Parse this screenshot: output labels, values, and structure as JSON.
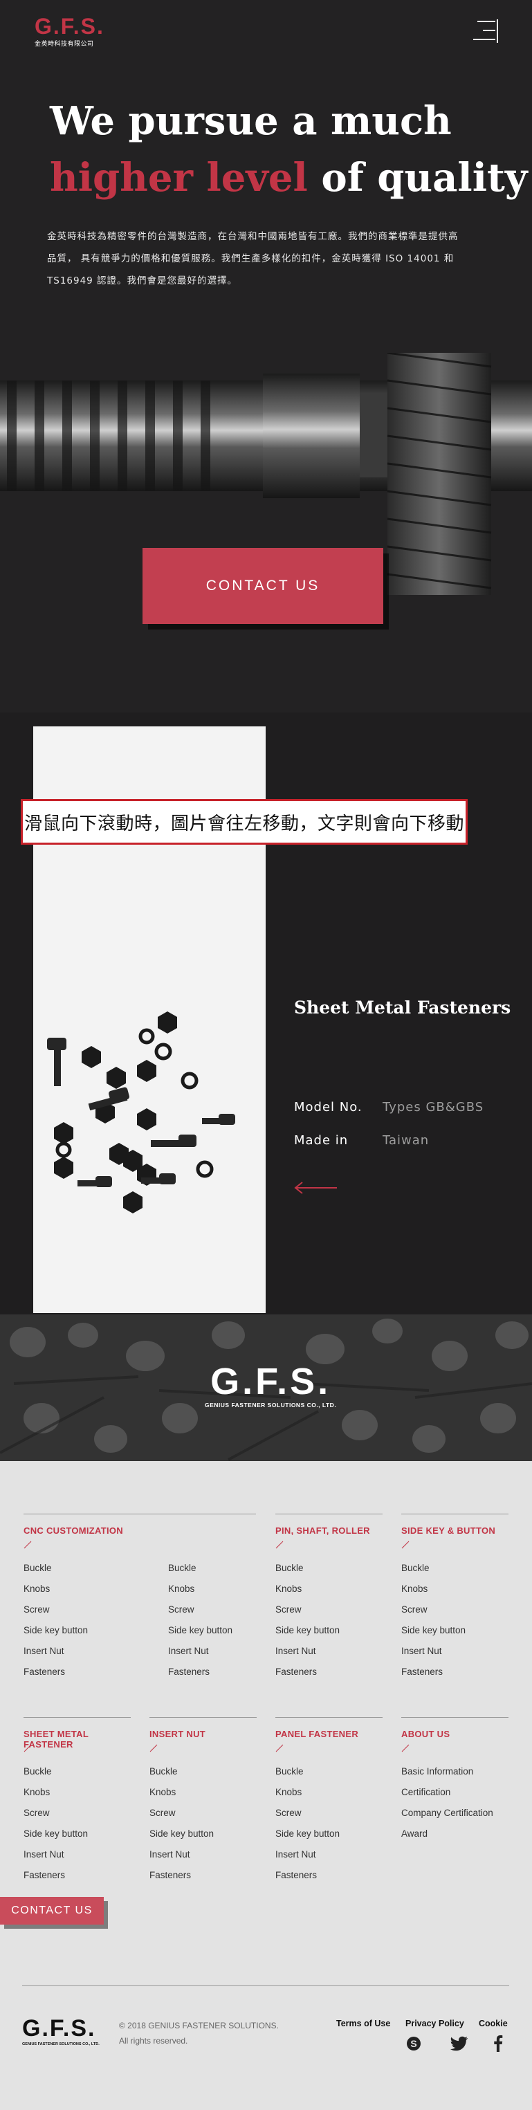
{
  "header": {
    "logo_text": "G.F.S.",
    "logo_subtitle": "金英時科技有限公司",
    "menu_icon": "menu-icon"
  },
  "hero": {
    "title_line1": "We pursue a much",
    "title_accent": "higher level",
    "title_rest": " of quality",
    "description": "金英時科技為精密零件的台灣製造商，在台灣和中國兩地皆有工廠。我們的商業標準是提供高品質， 具有競爭力的價格和優質服務。我們生產多樣化的扣件，金英時獲得 ISO 14001 和TS16949 認證。我們會是您最好的選擇。",
    "cta_label": "CONTACT  US"
  },
  "product": {
    "name": "Sheet Metal Fasteners",
    "specs": [
      {
        "key": "Model No.",
        "value": "Types GB&GBS"
      },
      {
        "key": "Made in",
        "value": "Taiwan"
      }
    ],
    "back_icon": "arrow-left-icon",
    "overlay_note": "滑鼠向下滾動時，圖片會往左移動，文字則會向下移動"
  },
  "banner": {
    "logo_text": "G.F.S.",
    "logo_subtitle": "GENIUS FASTENER SOLUTIONS CO., LTD."
  },
  "footer_nav": {
    "columns_top": [
      {
        "title": "CNC CUSTOMIZATION",
        "items": [
          "Buckle",
          "Knobs",
          "Screw",
          "Side key button",
          "Insert Nut",
          "Fasteners"
        ],
        "items2": [
          "Buckle",
          "Knobs",
          "Screw",
          "Side key button",
          "Insert Nut",
          "Fasteners"
        ]
      },
      {
        "title": "PIN, SHAFT, ROLLER",
        "items": [
          "Buckle",
          "Knobs",
          "Screw",
          "Side key button",
          "Insert Nut",
          "Fasteners"
        ]
      },
      {
        "title": "SIDE KEY & BUTTON",
        "items": [
          "Buckle",
          "Knobs",
          "Screw",
          "Side key button",
          "Insert Nut",
          "Fasteners"
        ]
      }
    ],
    "columns_bottom": [
      {
        "title": "SHEET METAL FASTENER",
        "items": [
          "Buckle",
          "Knobs",
          "Screw",
          "Side key button",
          "Insert Nut",
          "Fasteners"
        ]
      },
      {
        "title": "INSERT NUT",
        "items": [
          "Buckle",
          "Knobs",
          "Screw",
          "Side key button",
          "Insert Nut",
          "Fasteners"
        ]
      },
      {
        "title": "PANEL FASTENER",
        "items": [
          "Buckle",
          "Knobs",
          "Screw",
          "Side key button",
          "Insert Nut",
          "Fasteners"
        ]
      },
      {
        "title": "ABOUT US",
        "items": [
          "Basic Information",
          "Certification",
          "Company Certification",
          "Award"
        ]
      }
    ],
    "cta_label": "CONTACT  US"
  },
  "footer": {
    "logo_text": "G.F.S.",
    "logo_subtitle": "GENIUS FASTENER SOLUTIONS CO., LTD.",
    "copyright_line1": "© 2018 GENIUS FASTENER SOLUTIONS.",
    "copyright_line2": "All rights reserved.",
    "links": [
      "Terms of Use",
      "Privacy Policy",
      "Cookie"
    ],
    "social": [
      "skype-icon",
      "twitter-icon",
      "facebook-icon"
    ]
  },
  "colors": {
    "accent": "#c23546",
    "dark_bg": "#1f1e1f",
    "light_bg": "#e3e3e3",
    "note_border": "#c7222a"
  }
}
